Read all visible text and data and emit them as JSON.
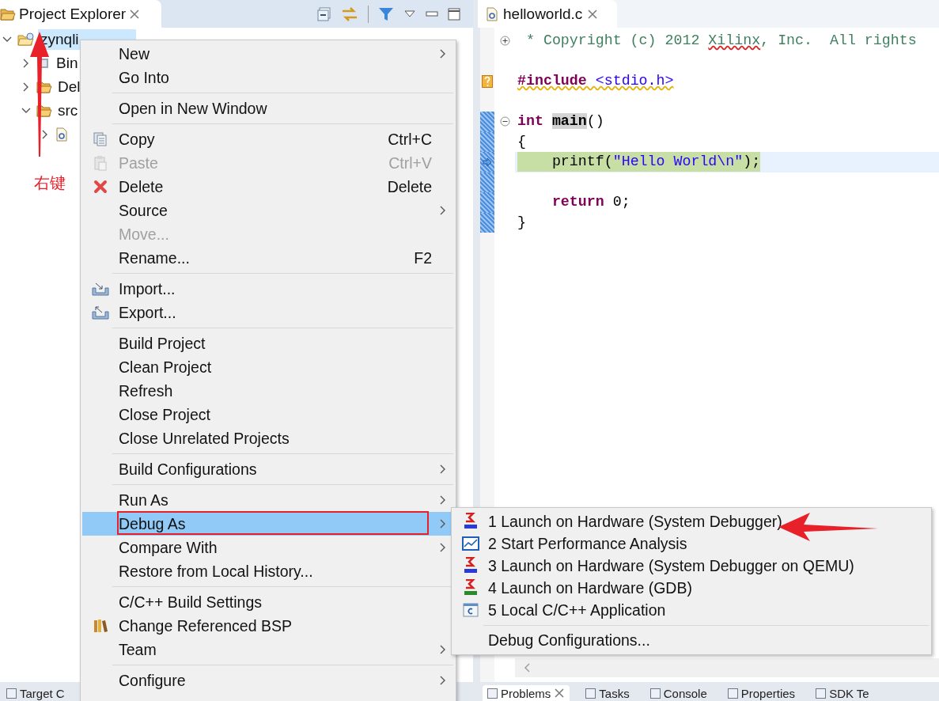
{
  "explorer": {
    "title": "Project Explorer",
    "tree": [
      {
        "label": "zynqli",
        "kind": "project",
        "expanded": true,
        "selected": true,
        "children": [
          {
            "label": "Bin",
            "kind": "binaries",
            "expanded": false,
            "selected": false
          },
          {
            "label": "Del",
            "kind": "folder",
            "expanded": false,
            "selected": false
          },
          {
            "label": "src",
            "kind": "folder",
            "expanded": true,
            "selected": false,
            "children": [
              {
                "kind": "file",
                "expanded": false,
                "selected": false
              }
            ]
          }
        ]
      }
    ]
  },
  "editor": {
    "tab": "helloworld.c",
    "lines": [
      {
        "in_scope": false,
        "current": false,
        "warning": false,
        "collapsed": true,
        "tokens": [
          {
            "text": " * Copyright (c) 2012 ",
            "kind": "comment"
          },
          {
            "text": "Xilinx",
            "kind": "comment",
            "misspelled": true
          },
          {
            "text": ", Inc.  All rights",
            "kind": "comment"
          }
        ]
      },
      {
        "in_scope": false,
        "current": false,
        "warning": false
      },
      {
        "in_scope": false,
        "current": false,
        "warning": true,
        "tokens": [
          {
            "text": "#include ",
            "kind": "keyword"
          },
          {
            "text": "<stdio.h>",
            "kind": "string"
          }
        ]
      },
      {
        "in_scope": false,
        "current": false,
        "warning": false
      },
      {
        "in_scope": true,
        "current": false,
        "warning": false,
        "collapsed": false,
        "tokens": [
          {
            "text": "int ",
            "kind": "keyword"
          },
          {
            "text": "main",
            "kind": "function",
            "marked": true
          },
          {
            "text": "()",
            "kind": "plain"
          }
        ]
      },
      {
        "in_scope": true,
        "current": false,
        "warning": false,
        "tokens": [
          {
            "text": "{",
            "kind": "plain"
          }
        ]
      },
      {
        "in_scope": true,
        "current": true,
        "warning": false,
        "tokens": [
          {
            "text": "    printf(",
            "kind": "plain"
          },
          {
            "text": "\"Hello World\\n\"",
            "kind": "string"
          },
          {
            "text": ");",
            "kind": "plain"
          }
        ]
      },
      {
        "in_scope": true,
        "current": false,
        "warning": false
      },
      {
        "in_scope": true,
        "current": false,
        "warning": false,
        "tokens": [
          {
            "text": "    return",
            "kind": "keyword"
          },
          {
            "text": " 0;",
            "kind": "plain"
          }
        ]
      },
      {
        "in_scope": true,
        "current": false,
        "warning": false,
        "tokens": [
          {
            "text": "}",
            "kind": "plain"
          }
        ]
      }
    ]
  },
  "context_menu": {
    "groups": [
      [
        {
          "label": "New",
          "kind": "plain",
          "has_submenu": true,
          "disabled": false,
          "selected": false
        },
        {
          "label": "Go Into",
          "kind": "plain",
          "has_submenu": false,
          "disabled": false,
          "selected": false
        }
      ],
      [
        {
          "label": "Open in New Window",
          "kind": "plain",
          "has_submenu": false,
          "disabled": false,
          "selected": false
        }
      ],
      [
        {
          "label": "Copy",
          "kind": "copy",
          "shortcut": "Ctrl+C",
          "has_submenu": false,
          "disabled": false,
          "selected": false
        },
        {
          "label": "Paste",
          "kind": "paste",
          "shortcut": "Ctrl+V",
          "has_submenu": false,
          "disabled": true,
          "selected": false
        },
        {
          "label": "Delete",
          "kind": "delete",
          "shortcut": "Delete",
          "has_submenu": false,
          "disabled": false,
          "selected": false
        },
        {
          "label": "Source",
          "kind": "plain",
          "has_submenu": true,
          "disabled": false,
          "selected": false
        },
        {
          "label": "Move...",
          "kind": "plain",
          "has_submenu": false,
          "disabled": true,
          "selected": false
        },
        {
          "label": "Rename...",
          "kind": "plain",
          "shortcut": "F2",
          "has_submenu": false,
          "disabled": false,
          "selected": false
        }
      ],
      [
        {
          "label": "Import...",
          "kind": "import",
          "has_submenu": false,
          "disabled": false,
          "selected": false
        },
        {
          "label": "Export...",
          "kind": "export",
          "has_submenu": false,
          "disabled": false,
          "selected": false
        }
      ],
      [
        {
          "label": "Build Project",
          "kind": "plain",
          "has_submenu": false,
          "disabled": false,
          "selected": false
        },
        {
          "label": "Clean Project",
          "kind": "plain",
          "has_submenu": false,
          "disabled": false,
          "selected": false
        },
        {
          "label": "Refresh",
          "kind": "plain",
          "has_submenu": false,
          "disabled": false,
          "selected": false
        },
        {
          "label": "Close Project",
          "kind": "plain",
          "has_submenu": false,
          "disabled": false,
          "selected": false
        },
        {
          "label": "Close Unrelated Projects",
          "kind": "plain",
          "has_submenu": false,
          "disabled": false,
          "selected": false
        }
      ],
      [
        {
          "label": "Build Configurations",
          "kind": "plain",
          "has_submenu": true,
          "disabled": false,
          "selected": false
        }
      ],
      [
        {
          "label": "Run As",
          "kind": "plain",
          "has_submenu": true,
          "disabled": false,
          "selected": false
        },
        {
          "label": "Debug As",
          "kind": "plain",
          "has_submenu": true,
          "disabled": false,
          "selected": true
        },
        {
          "label": "Compare With",
          "kind": "plain",
          "has_submenu": true,
          "disabled": false,
          "selected": false
        },
        {
          "label": "Restore from Local History...",
          "kind": "plain",
          "has_submenu": false,
          "disabled": false,
          "selected": false
        }
      ],
      [
        {
          "label": "C/C++ Build Settings",
          "kind": "plain",
          "has_submenu": false,
          "disabled": false,
          "selected": false
        },
        {
          "label": "Change Referenced BSP",
          "kind": "bsp",
          "has_submenu": false,
          "disabled": false,
          "selected": false
        },
        {
          "label": "Team",
          "kind": "plain",
          "has_submenu": true,
          "disabled": false,
          "selected": false
        }
      ],
      [
        {
          "label": "Configure",
          "kind": "plain",
          "has_submenu": true,
          "disabled": false,
          "selected": false
        }
      ]
    ]
  },
  "submenu": {
    "groups": [
      [
        {
          "label": "1 Launch on Hardware (System Debugger)",
          "kind": "tcf"
        },
        {
          "label": "2 Start Performance Analysis",
          "kind": "chart"
        },
        {
          "label": "3 Launch on Hardware (System Debugger on QEMU)",
          "kind": "tcf"
        },
        {
          "label": "4 Launch on Hardware (GDB)",
          "kind": "gdb"
        },
        {
          "label": "5 Local C/C++ Application",
          "kind": "c-app"
        }
      ],
      [
        {
          "label": "Debug Configurations...",
          "kind": "plain"
        }
      ]
    ]
  },
  "bottom_tabs": {
    "left": [
      {
        "label": "Target C",
        "selected": false
      }
    ],
    "right": [
      {
        "label": "Problems",
        "selected": true
      },
      {
        "label": "Tasks",
        "selected": false
      },
      {
        "label": "Console",
        "selected": false
      },
      {
        "label": "Properties",
        "selected": false
      },
      {
        "label": "SDK Te",
        "selected": false
      }
    ]
  },
  "annotation": {
    "note": "右键"
  }
}
